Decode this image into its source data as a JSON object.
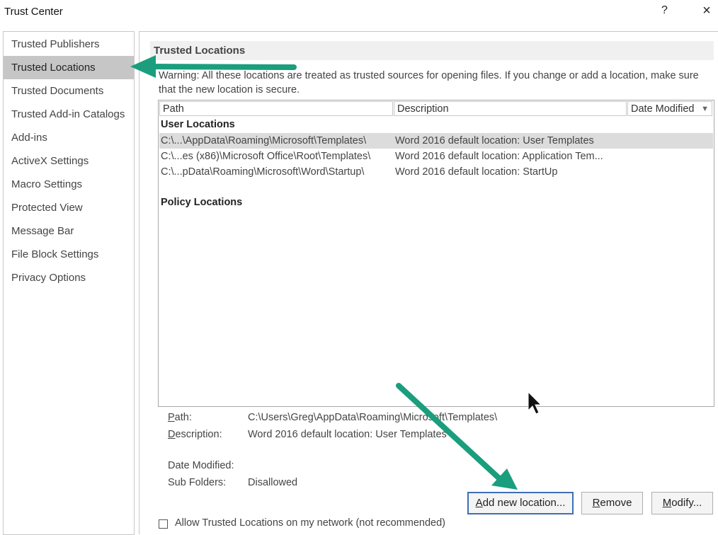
{
  "window": {
    "title": "Trust Center",
    "help_icon": "?",
    "close_icon": "×"
  },
  "sidebar": {
    "items": [
      {
        "label": "Trusted Publishers",
        "selected": false
      },
      {
        "label": "Trusted Locations",
        "selected": true
      },
      {
        "label": "Trusted Documents",
        "selected": false
      },
      {
        "label": "Trusted Add-in Catalogs",
        "selected": false
      },
      {
        "label": "Add-ins",
        "selected": false
      },
      {
        "label": "ActiveX Settings",
        "selected": false
      },
      {
        "label": "Macro Settings",
        "selected": false
      },
      {
        "label": "Protected View",
        "selected": false
      },
      {
        "label": "Message Bar",
        "selected": false
      },
      {
        "label": "File Block Settings",
        "selected": false
      },
      {
        "label": "Privacy Options",
        "selected": false
      }
    ]
  },
  "main": {
    "section_title": "Trusted Locations",
    "warning": "Warning: All these locations are treated as trusted sources for opening files.  If you change or add a location, make sure that the new location is secure.",
    "table": {
      "columns": [
        "Path",
        "Description",
        "Date Modified"
      ],
      "sort_icon": "chevron-down-icon",
      "user_locations_label": "User Locations",
      "policy_locations_label": "Policy Locations",
      "rows": [
        {
          "path": "C:\\...\\AppData\\Roaming\\Microsoft\\Templates\\",
          "description": "Word 2016 default location: User Templates",
          "selected": true
        },
        {
          "path": "C:\\...es (x86)\\Microsoft Office\\Root\\Templates\\",
          "description": "Word 2016 default location: Application Tem...",
          "selected": false
        },
        {
          "path": "C:\\...pData\\Roaming\\Microsoft\\Word\\Startup\\",
          "description": "Word 2016 default location: StartUp",
          "selected": false
        }
      ]
    },
    "details": {
      "path_label": "Path:",
      "path_value": "C:\\Users\\Greg\\AppData\\Roaming\\Microsoft\\Templates\\",
      "description_label": "Description:",
      "description_value": "Word 2016 default location: User Templates",
      "date_modified_label": "Date Modified:",
      "date_modified_value": "",
      "sub_folders_label": "Sub Folders:",
      "sub_folders_value": "Disallowed"
    },
    "buttons": {
      "add_new_location": "Add new location...",
      "remove": "Remove",
      "modify": "Modify..."
    },
    "allow_network_label": "Allow Trusted Locations on my network (not recommended)"
  },
  "annotations": {
    "arrow_color": "#1a9e7d"
  }
}
